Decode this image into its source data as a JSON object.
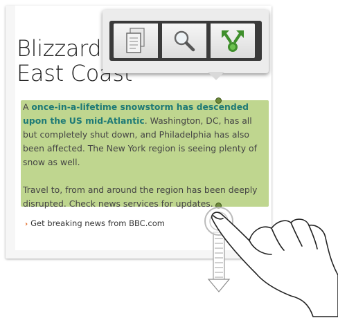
{
  "article": {
    "headline": "Blizzard hits\nEast Coast",
    "paragraph1_lead": "A ",
    "paragraph1_highlight": "once-in-a-lifetime snowstorm has descended upon the US mid-Atlantic",
    "paragraph1_rest": ". Washington, DC, has all but completely shut down, and Philadelphia has also been affected. The New York region is seeing plenty of snow as well.",
    "paragraph2": "Travel to, from and around the region has been deeply disrupted. Check news services for updates.",
    "more_link": "Get breaking news from BBC.com"
  },
  "popup": {
    "items": [
      {
        "icon": "copy-icon"
      },
      {
        "icon": "search-icon"
      },
      {
        "icon": "share-icon"
      }
    ]
  },
  "colors": {
    "selection": "#b4cf7b",
    "highlight_text": "#1e7a76",
    "link_chevron": "#e0621a"
  }
}
